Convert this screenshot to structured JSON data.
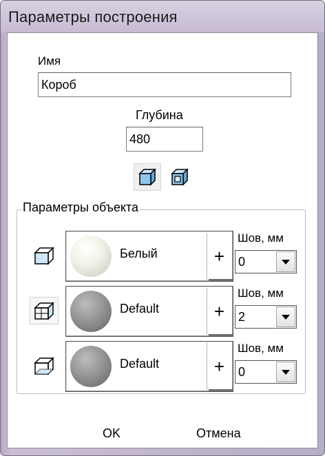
{
  "window": {
    "title": "Параметры построения"
  },
  "name_field": {
    "label": "Имя",
    "value": "Короб"
  },
  "depth_field": {
    "label": "Глубина",
    "value": "480"
  },
  "object_params": {
    "title": "Параметры объекта",
    "rows": [
      {
        "material": "Белый",
        "plus": "+",
        "seam_label": "Шов, мм",
        "seam_value": "0"
      },
      {
        "material": "Default",
        "plus": "+",
        "seam_label": "Шов, мм",
        "seam_value": "2"
      },
      {
        "material": "Default",
        "plus": "+",
        "seam_label": "Шов, мм",
        "seam_value": "0"
      }
    ]
  },
  "buttons": {
    "ok": "OK",
    "cancel": "Отмена"
  },
  "colors": {
    "sphere_white": "#e8e8dc",
    "sphere_grey": "#8a8a8a",
    "icon_blue": "#8fc5ea"
  }
}
